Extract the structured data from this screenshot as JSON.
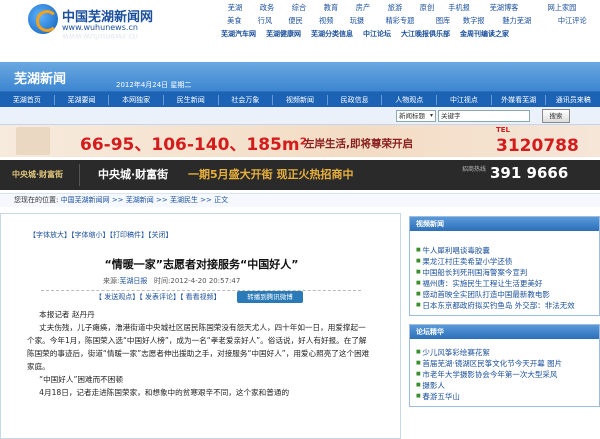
{
  "logo": {
    "title": "中国芜湖新闻网",
    "url": "www.wuhunews.cn"
  },
  "top_nav": {
    "row1": [
      "芜湖",
      "政务",
      "综合",
      "教育",
      "房产",
      "旅游",
      "原创",
      "手机报",
      "芜湖博客",
      "网上家园"
    ],
    "row2": [
      "美食",
      "行风",
      "便民",
      "视频",
      "玩摄",
      "精彩专题",
      "图库",
      "数字报",
      "魅力芜湖",
      "中江评论"
    ]
  },
  "special_links": [
    "芜湖汽车网",
    "芜湖健康网",
    "芜湖分类信息",
    "中江论坛",
    "大江晚报俱乐部",
    "金周刊编读之家"
  ],
  "banner": {
    "title": "芜湖新闻",
    "date": "2012年4月24日 星期二"
  },
  "main_nav": [
    "芜湖首页",
    "芜湖要闻",
    "本网独家",
    "民生新闻",
    "社会万象",
    "视频新闻",
    "民政信息",
    "人物观点",
    "中江视点",
    "外媒看芜湖",
    "通讯员来稿"
  ],
  "search": {
    "scope": "新闻标题",
    "keyword": "关键字",
    "button": "搜索"
  },
  "ad1": {
    "prices": "66-95、106-140、185m²",
    "slogan": "左岸生活,即将尊荣开启",
    "tel_label": "TEL",
    "phone": "3120788"
  },
  "ad2": {
    "brand": "中央城·财富街",
    "name": "中央城·财富街",
    "slogan": "一期5月盛大开街 现正火热招商中",
    "tel_label": "招商热线",
    "phone": "391 9666"
  },
  "breadcrumb": {
    "label": "您现在的位置:",
    "path": "中国芜湖新闻网 >> 芜湖新闻 >> 芜湖民生 >> 正文"
  },
  "article": {
    "tools": "【字体放大】【字体缩小】【打印稿件】【关闭】",
    "title": "“情暖一家”志愿者对接服务“中国好人”",
    "source_label": "来源:",
    "source": "芜湖日报",
    "time_label": "时间:",
    "time": "2012-4-20 20:57:47",
    "actions": "【 发送观点】【 发表评论】【 看看视频】",
    "weibo": "转播到腾讯微博",
    "paragraphs": [
      "本报记者 赵丹丹",
      "丈夫伤残，儿子瘫痪，澛港街道中央城社区居民陈国荣没有怨天尤人，四十年如一日，用爱撑起一个家。今年1月，陈国荣入选“中国好人榜”，成为一名“孝老爱亲好人”。俗话说，好人有好报。在了解陈国荣的事迹后，街道“情暖一家”志愿者伸出援助之手，对接服务“中国好人”，用爱心照亮了这个困难家庭。",
      "“中国好人”困难而不困顿",
      "4月18日，记者走进陈国荣家，和想象中的贫寒艰辛不同，这个家和普通的"
    ]
  },
  "sidebar": {
    "video_title": "视频新闻",
    "video_news": [
      "牛人犀利唱谈毒胶囊",
      "果龙江村庄卖希望小学还债",
      "中国船长判死刑国海警案今宣判",
      "福州唐：实施民生工程让生活更美好",
      "感动首映全实团队打造中国最新教电影",
      "日本东京都政府拟买钓鱼岛 外交部：非法无效"
    ],
    "forum_title": "论坛精华",
    "forum_posts": [
      "少儿风筝彩绘赛花絮",
      "首届芜湖·镜湖区民筝文化节今天开幕 图片",
      "市老年大学摄影协会今年第一次大型采风",
      "摄影人",
      "春游五华山"
    ]
  }
}
